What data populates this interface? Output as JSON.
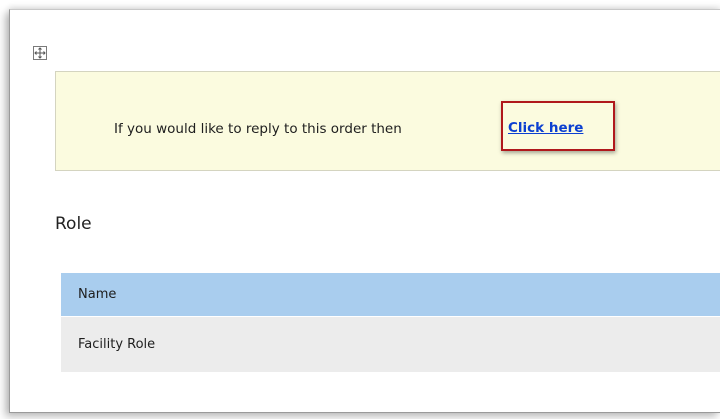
{
  "notice": {
    "text": "If you would like to reply to this order then",
    "link_label": "Click here",
    "highlight_color": "#b0181c",
    "background": "#fbfbdf"
  },
  "role_section": {
    "heading": "Role",
    "table": {
      "columns": [
        "Name"
      ],
      "rows": [
        [
          "Facility Role"
        ]
      ],
      "header_color": "#a9cdee",
      "row_color": "#ececec"
    }
  },
  "icons": {
    "move_handle": "move-arrows-icon"
  }
}
